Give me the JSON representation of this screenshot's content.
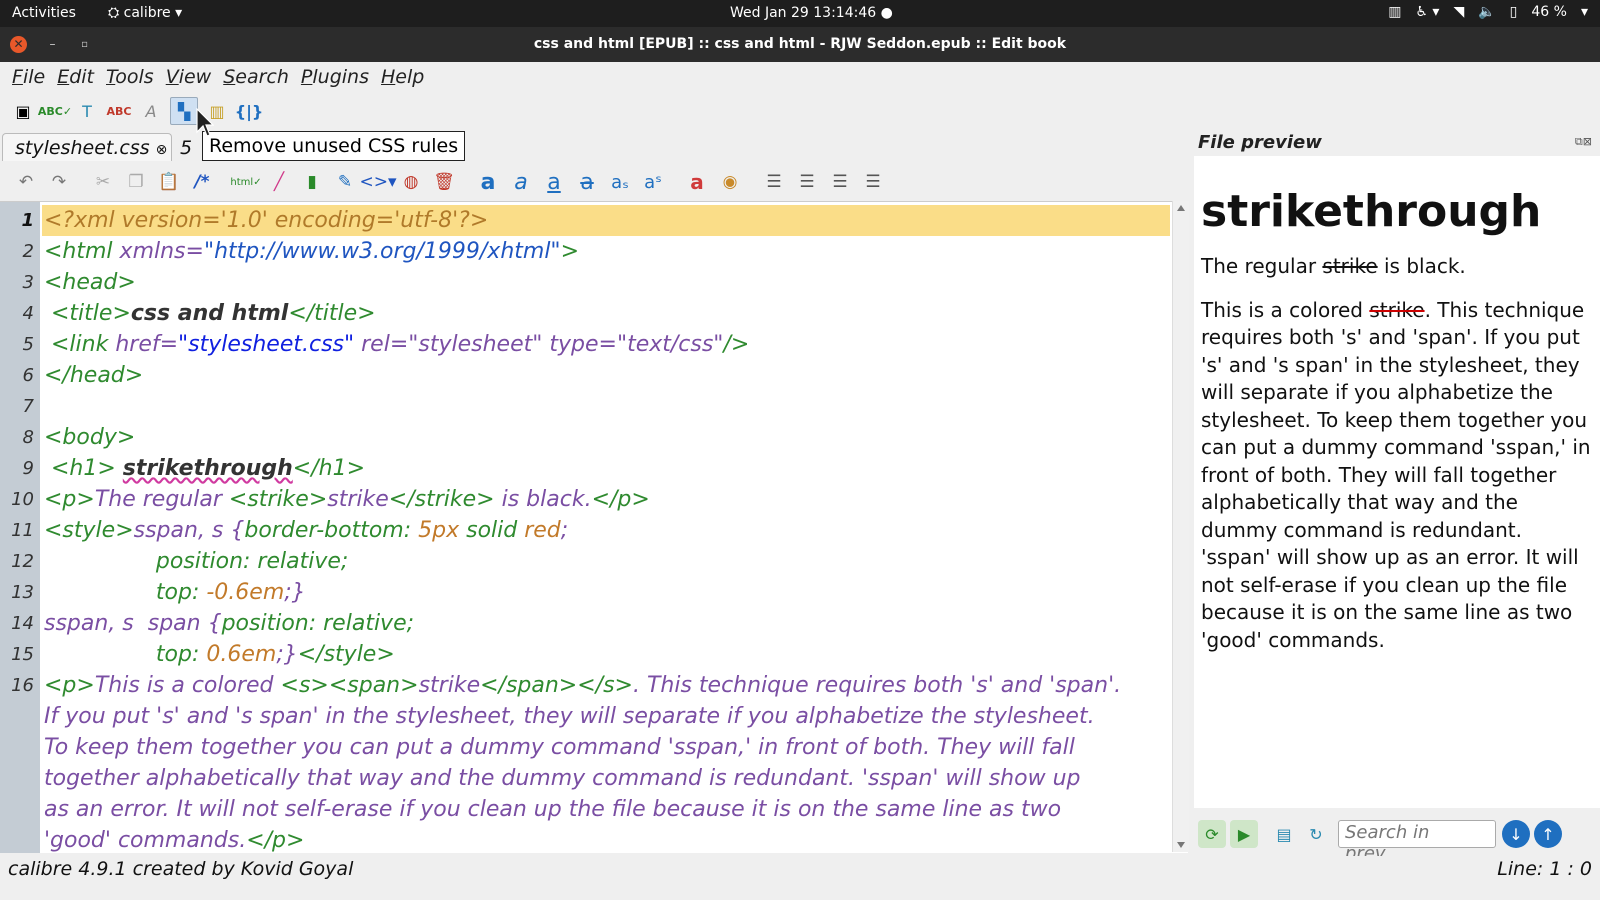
{
  "system": {
    "activities": "Activities",
    "app_name": "calibre",
    "clock": "Wed Jan 29  13:14:46",
    "battery": "46 %"
  },
  "window": {
    "title": "css and html [EPUB] :: css and html - RJW Seddon.epub :: Edit book"
  },
  "menu": [
    "File",
    "Edit",
    "Tools",
    "View",
    "Search",
    "Plugins",
    "Help"
  ],
  "tooltip": "Remove unused CSS rules",
  "tabs": {
    "active": "stylesheet.css",
    "second_partial": "5"
  },
  "editor": {
    "line_numbers": [
      "1",
      "2",
      "3",
      "4",
      "5",
      "6",
      "7",
      "8",
      "9",
      "10",
      "11",
      "12",
      "13",
      "14",
      "15",
      "16"
    ],
    "lines": {
      "l1": "<?xml version='1.0' encoding='utf-8'?>",
      "l2a": "<html ",
      "l2b": "xmlns=",
      "l2c": "\"http://www.w3.org/1999/xhtml\"",
      "l2d": ">",
      "l3": "<head>",
      "l4a": " <title>",
      "l4b": "css and html",
      "l4c": "</title>",
      "l5a": " <link ",
      "l5b": "href=",
      "l5c": "\"stylesheet.css\"",
      "l5d": " rel=",
      "l5e": "\"stylesheet\"",
      "l5f": " type=",
      "l5g": "\"text/css\"",
      "l5h": "/>",
      "l6": "</head>",
      "l8": "<body>",
      "l9a": " <h1> ",
      "l9b": "strikethrough",
      "l9c": "</h1>",
      "l10a": "<p>",
      "l10b": "The regular ",
      "l10c": "<strike>",
      "l10d": "strike",
      "l10e": "</strike>",
      "l10f": " is black.",
      "l10g": "</p>",
      "l11a": "<style>",
      "l11b": "sspan, s {",
      "l11c": "border-bottom: ",
      "l11d": "5px",
      "l11e": " solid ",
      "l11f": "red",
      "l11g": ";",
      "l12": "                position: relative;",
      "l13a": "                top: ",
      "l13b": "-0.6em",
      "l13c": ";}",
      "l14a": "sspan, s  span {",
      "l14b": "position: relative;",
      "l15a": "                top: ",
      "l15b": "0.6em",
      "l15c": ";}",
      "l15d": "</style>",
      "l16a": "<p>",
      "l16b": "This is a colored ",
      "l16c": "<s><span>",
      "l16d": "strike",
      "l16e": "</span></s>",
      "l16f": ". This technique requires both 's' and 'span'.",
      "w1": "If you put 's' and 's span' in the stylesheet, they will separate if you alphabetize the stylesheet.",
      "w2": "To keep them together you can put a dummy command 'sspan,' in front of both. They will fall",
      "w3": "together alphabetically that way and the dummy command is redundant. 'sspan' will show up",
      "w4": "as an error. It will not self-erase if you clean up the file because it is on the same line as two",
      "w5a": "'good' commands.",
      "w5b": "</p>"
    }
  },
  "preview": {
    "header": "File preview",
    "h1": "strikethrough",
    "p1_before": "The regular ",
    "p1_strike": "strike",
    "p1_after": " is black.",
    "p2_before": "This is a colored ",
    "p2_strike": "strike",
    "p2_after": ". This technique requires both 's' and 'span'. If you put 's' and 's span' in the stylesheet, they will separate if you alphabetize the stylesheet. To keep them together you can put a dummy command 'sspan,' in front of both. They will fall together alphabetically that way and the dummy command is redundant. 'sspan' will show up as an error. It will not self-erase if you clean up the file because it is on the same line as two 'good' commands.",
    "search_placeholder": "Search in prev..."
  },
  "status": {
    "left": "calibre 4.9.1 created by Kovid Goyal",
    "right": "Line: 1 : 0"
  }
}
